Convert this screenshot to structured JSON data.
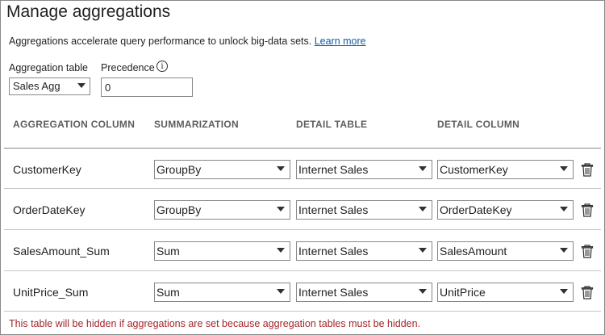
{
  "title": "Manage aggregations",
  "description": "Aggregations accelerate query performance to unlock big-data sets.",
  "learn_more": "Learn more",
  "agg_table": {
    "label": "Aggregation table",
    "value": "Sales Agg"
  },
  "precedence": {
    "label": "Precedence",
    "value": "0",
    "info_glyph": "i"
  },
  "columns": {
    "aggregation_column": "AGGREGATION COLUMN",
    "summarization": "SUMMARIZATION",
    "detail_table": "DETAIL TABLE",
    "detail_column": "DETAIL COLUMN"
  },
  "rows": [
    {
      "name": "CustomerKey",
      "summarization": "GroupBy",
      "detail_table": "Internet Sales",
      "detail_column": "CustomerKey"
    },
    {
      "name": "OrderDateKey",
      "summarization": "GroupBy",
      "detail_table": "Internet Sales",
      "detail_column": "OrderDateKey"
    },
    {
      "name": "SalesAmount_Sum",
      "summarization": "Sum",
      "detail_table": "Internet Sales",
      "detail_column": "SalesAmount"
    },
    {
      "name": "UnitPrice_Sum",
      "summarization": "Sum",
      "detail_table": "Internet Sales",
      "detail_column": "UnitPrice"
    }
  ],
  "warning": "This table will be hidden if aggregations are set because aggregation tables must be hidden.",
  "colors": {
    "link": "#0f5fa8",
    "warning": "#a4262c",
    "header_text": "#605e5c"
  },
  "icons": {
    "delete": "trash-icon",
    "dropdown": "chevron-down-icon",
    "info": "info-icon"
  }
}
